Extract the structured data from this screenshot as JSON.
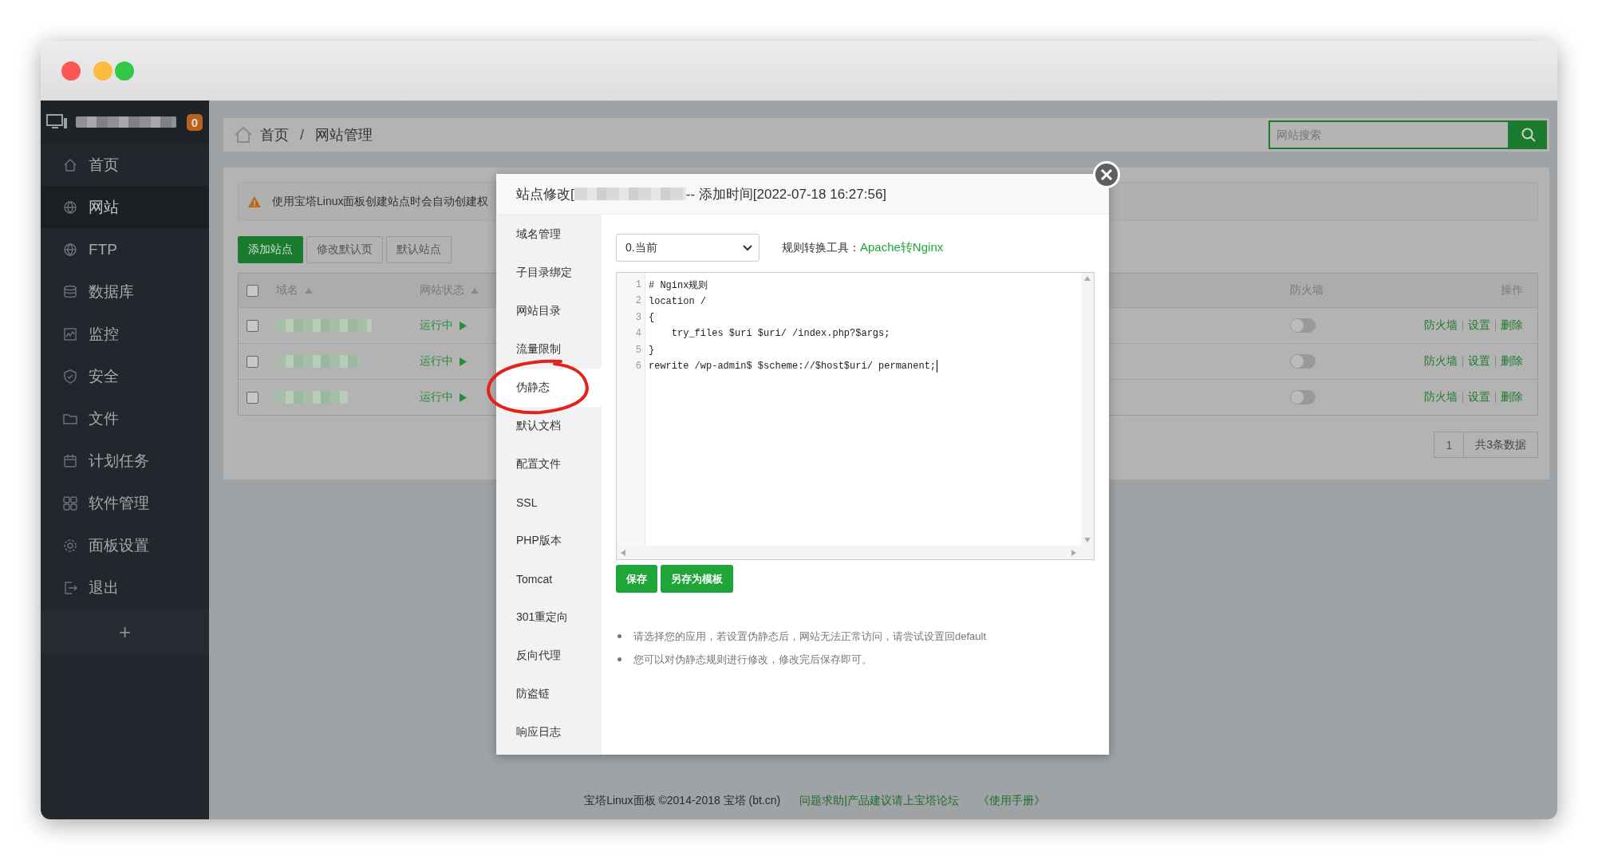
{
  "sidebar": {
    "badge": "0",
    "items": [
      {
        "label": "首页",
        "selected": false
      },
      {
        "label": "网站",
        "selected": true
      },
      {
        "label": "FTP",
        "selected": false
      },
      {
        "label": "数据库",
        "selected": false
      },
      {
        "label": "监控",
        "selected": false
      },
      {
        "label": "安全",
        "selected": false
      },
      {
        "label": "文件",
        "selected": false
      },
      {
        "label": "计划任务",
        "selected": false
      },
      {
        "label": "软件管理",
        "selected": false
      },
      {
        "label": "面板设置",
        "selected": false
      },
      {
        "label": "退出",
        "selected": false
      }
    ],
    "add_button": "+"
  },
  "breadcrumb": {
    "items": [
      "首页",
      "网站管理"
    ],
    "separator": "/"
  },
  "search": {
    "placeholder": "网站搜索"
  },
  "notice": "使用宝塔Linux面板创建站点时会自动创建权",
  "toolbar": [
    {
      "label": "添加站点",
      "primary": true
    },
    {
      "label": "修改默认页",
      "primary": false
    },
    {
      "label": "默认站点",
      "primary": false
    }
  ],
  "table": {
    "select_all_checked": false,
    "columns": [
      {
        "label": "域名",
        "sortable": true
      },
      {
        "label": "网站状态",
        "sortable": true
      },
      {
        "label": "防火墙"
      },
      {
        "label": "操作"
      }
    ],
    "rows": [
      {
        "checked": false,
        "status": "运行中",
        "firewall_on": false,
        "actions": [
          "防火墙",
          "设置",
          "删除"
        ]
      },
      {
        "checked": false,
        "status": "运行中",
        "firewall_on": false,
        "actions": [
          "防火墙",
          "设置",
          "删除"
        ]
      },
      {
        "checked": false,
        "status": "运行中",
        "firewall_on": false,
        "actions": [
          "防火墙",
          "设置",
          "删除"
        ]
      }
    ]
  },
  "pagination": {
    "page": "1",
    "total": "共3条数据"
  },
  "modal": {
    "title_prefix": "站点修改[",
    "title_suffix": "-- 添加时间[2022-07-18 16:27:56]",
    "nav": [
      {
        "label": "域名管理",
        "selected": false
      },
      {
        "label": "子目录绑定",
        "selected": false
      },
      {
        "label": "网站目录",
        "selected": false
      },
      {
        "label": "流量限制",
        "selected": false
      },
      {
        "label": "伪静态",
        "selected": true
      },
      {
        "label": "默认文档",
        "selected": false
      },
      {
        "label": "配置文件",
        "selected": false
      },
      {
        "label": "SSL",
        "selected": false
      },
      {
        "label": "PHP版本",
        "selected": false
      },
      {
        "label": "Tomcat",
        "selected": false
      },
      {
        "label": "301重定向",
        "selected": false
      },
      {
        "label": "反向代理",
        "selected": false
      },
      {
        "label": "防盗链",
        "selected": false
      },
      {
        "label": "响应日志",
        "selected": false
      }
    ],
    "rule_select": {
      "value": "0.当前"
    },
    "converter_label": "规则转换工具：",
    "converter_link": "Apache转Nginx",
    "editor": {
      "lines": [
        {
          "number": "1",
          "text": "# Nginx规则"
        },
        {
          "number": "2",
          "text": "location /"
        },
        {
          "number": "3",
          "text": "{"
        },
        {
          "number": "4",
          "text": "    try_files $uri $uri/ /index.php?$args;"
        },
        {
          "number": "5",
          "text": "}"
        },
        {
          "number": "6",
          "text": "rewrite /wp-admin$ $scheme://$host$uri/ permanent;"
        }
      ]
    },
    "buttons": [
      "保存",
      "另存为模板"
    ],
    "notes": [
      "请选择您的应用，若设置伪静态后，网站无法正常访问，请尝试设置回default",
      "您可以对伪静态规则进行修改，修改完后保存即可。"
    ]
  },
  "footer": {
    "copyright": "宝塔Linux面板 ©2014-2018 宝塔 (bt.cn)",
    "links": [
      "问题求助|产品建议请上宝塔论坛",
      "《使用手册》"
    ]
  }
}
